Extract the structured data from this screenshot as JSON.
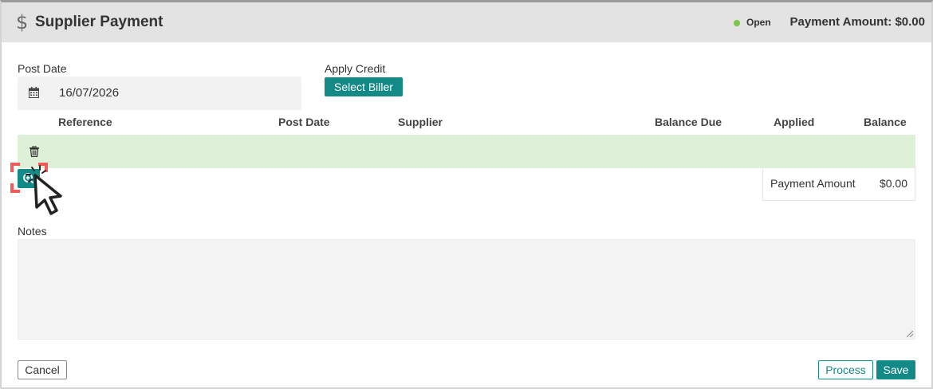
{
  "header": {
    "currency_symbol": "$",
    "title": "Supplier Payment",
    "status": "Open",
    "status_color": "#7cc44a",
    "payment_amount_label": "Payment Amount: $0.00"
  },
  "form": {
    "post_date_label": "Post Date",
    "post_date_value": "16/07/2026",
    "post_date_icon": "calendar-icon",
    "apply_credit_label": "Apply Credit",
    "select_biller_label": "Select Biller"
  },
  "table": {
    "columns": [
      "Reference",
      "Post Date",
      "Supplier",
      "Balance Due",
      "Applied",
      "Balance"
    ],
    "row_highlight_color": "#dff0d8",
    "delete_icon": "trash-icon",
    "zoom_icon": "zoom-in-icon"
  },
  "summary": {
    "label": "Payment Amount",
    "value": "$0.00"
  },
  "notes": {
    "label": "Notes",
    "value": ""
  },
  "footer": {
    "cancel_label": "Cancel",
    "process_label": "Process",
    "save_label": "Save"
  },
  "colors": {
    "accent": "#138a86",
    "header_bg": "#e3e3e3",
    "focus_highlight": "#f05a5a"
  }
}
